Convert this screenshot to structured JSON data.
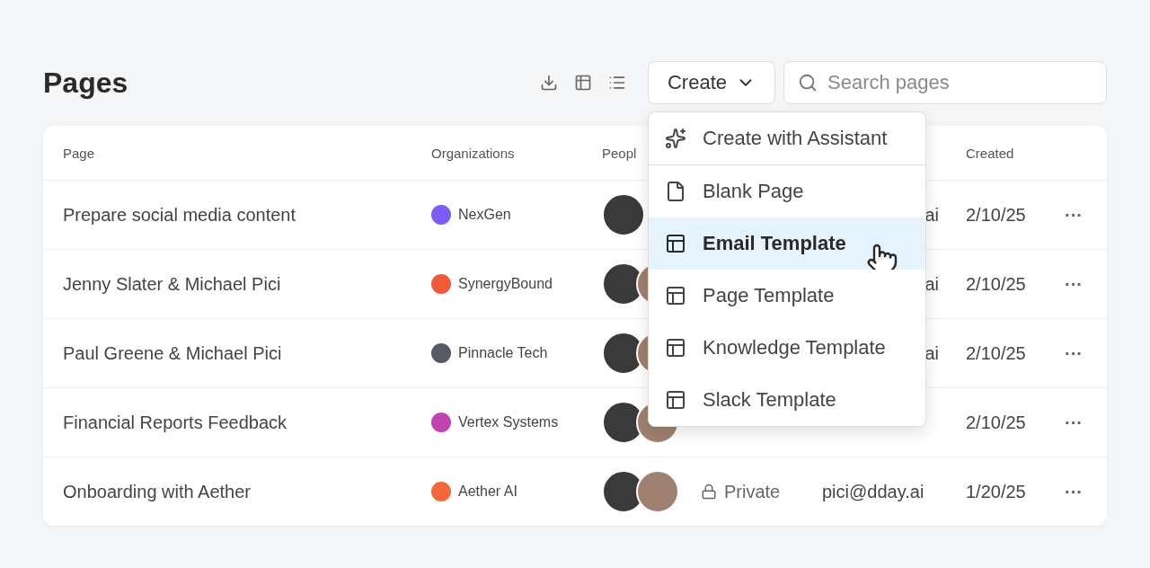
{
  "header": {
    "title": "Pages"
  },
  "toolbar": {
    "create_label": "Create",
    "search": {
      "placeholder": "Search pages"
    }
  },
  "menu": {
    "items": [
      {
        "label": "Create with Assistant",
        "kind": "assistant",
        "selected": false
      },
      {
        "label": "Blank Page",
        "kind": "blank",
        "selected": false
      },
      {
        "label": "Email Template",
        "kind": "template",
        "selected": true
      },
      {
        "label": "Page Template",
        "kind": "template",
        "selected": false
      },
      {
        "label": "Knowledge Template",
        "kind": "template",
        "selected": false
      },
      {
        "label": "Slack Template",
        "kind": "template",
        "selected": false
      }
    ]
  },
  "table": {
    "columns": [
      {
        "label": "Page",
        "kind": "page"
      },
      {
        "label": "Organizations",
        "kind": "org"
      },
      {
        "label": "Peopl",
        "kind": "people"
      },
      {
        "kind": "visibility"
      },
      {
        "kind": "owner"
      },
      {
        "label": "Created",
        "kind": "created"
      }
    ],
    "rows": [
      {
        "page": "Prepare social media content",
        "org": {
          "name": "NexGen",
          "color": "#7b5cf5"
        },
        "people": [
          {
            "kind": "avatar"
          }
        ],
        "owner_tail": "ai",
        "created": "2/10/25",
        "more": "···"
      },
      {
        "page": "Jenny Slater & Michael Pici",
        "org": {
          "name": "SynergyBound",
          "color": "#f05a3a"
        },
        "people": [
          {
            "kind": "avatar"
          },
          {
            "kind": "avatar"
          }
        ],
        "owner_tail": "ai",
        "created": "2/10/25",
        "more": "···"
      },
      {
        "page": "Paul Greene & Michael Pici",
        "org": {
          "name": "Pinnacle Tech",
          "color": "#555a66"
        },
        "people": [
          {
            "kind": "avatar"
          },
          {
            "kind": "avatar"
          }
        ],
        "owner_tail": "ai",
        "created": "2/10/25",
        "more": "···"
      },
      {
        "page": "Financial Reports Feedback",
        "org": {
          "name": "Vertex Systems",
          "color": "#c044b0"
        },
        "people": [
          {
            "kind": "avatar"
          },
          {
            "kind": "avatar"
          }
        ],
        "created": "2/10/25",
        "more": "···"
      },
      {
        "page": "Onboarding with Aether",
        "org": {
          "name": "Aether AI",
          "color": "#f2683a"
        },
        "people": [
          {
            "kind": "avatar"
          },
          {
            "kind": "avatar"
          }
        ],
        "visibility": {
          "label": "Private",
          "kind": "lock"
        },
        "owner": "pici@dday.ai",
        "created": "1/20/25",
        "more": "···"
      }
    ]
  }
}
